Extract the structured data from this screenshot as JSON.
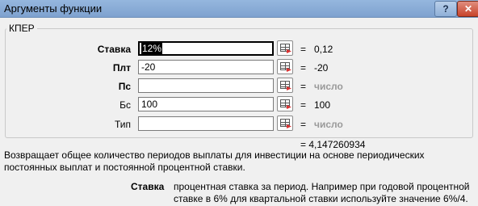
{
  "window": {
    "title": "Аргументы функции",
    "help_glyph": "?",
    "close_glyph": "✕"
  },
  "function": {
    "name": "КПЕР",
    "result_prefix": "= 4,147260934",
    "description": "Возвращает общее количество периодов выплаты для инвестиции на основе периодических постоянных выплат и постоянной процентной ставки.",
    "current_arg_name": "Ставка",
    "current_arg_description": "процентная ставка за период. Например при годовой процентной ставке в 6% для квартальной ставки используйте значение 6%/4."
  },
  "args": [
    {
      "label": "Ставка",
      "bold": true,
      "value": "12%",
      "eq": "=",
      "evaluated": "0,12",
      "hint": false
    },
    {
      "label": "Плт",
      "bold": true,
      "value": "-20",
      "eq": "=",
      "evaluated": "-20",
      "hint": false
    },
    {
      "label": "Пс",
      "bold": true,
      "value": "",
      "eq": "=",
      "evaluated": "число",
      "hint": true
    },
    {
      "label": "Бс",
      "bold": false,
      "value": "100",
      "eq": "=",
      "evaluated": "100",
      "hint": false
    },
    {
      "label": "Тип",
      "bold": false,
      "value": "",
      "eq": "=",
      "evaluated": "число",
      "hint": true
    }
  ],
  "icons": {
    "ref_button": "range-select-icon"
  }
}
